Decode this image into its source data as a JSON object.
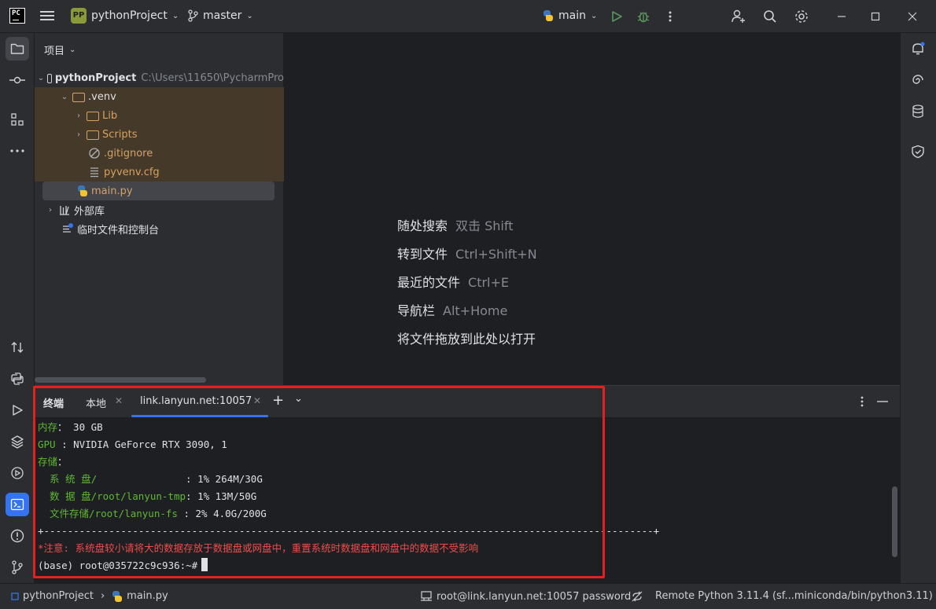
{
  "titlebar": {
    "logo": "PC",
    "project_badge": "PP",
    "project_name": "pythonProject",
    "branch": "master",
    "run_config": "main"
  },
  "project_panel": {
    "header": "项目",
    "tree": [
      {
        "label": "pythonProject",
        "hint": "C:\\Users\\11650\\PycharmPro"
      },
      {
        "label": ".venv"
      },
      {
        "label": "Lib"
      },
      {
        "label": "Scripts"
      },
      {
        "label": ".gitignore"
      },
      {
        "label": "pyvenv.cfg"
      },
      {
        "label": "main.py"
      },
      {
        "label": "外部库"
      },
      {
        "label": "临时文件和控制台"
      }
    ]
  },
  "editor_empty": {
    "rows": [
      {
        "label": "随处搜索",
        "shortcut": "双击 Shift"
      },
      {
        "label": "转到文件",
        "shortcut": "Ctrl+Shift+N"
      },
      {
        "label": "最近的文件",
        "shortcut": "Ctrl+E"
      },
      {
        "label": "导航栏",
        "shortcut": "Alt+Home"
      },
      {
        "label": "将文件拖放到此处以打开",
        "shortcut": ""
      }
    ]
  },
  "terminal": {
    "title": "终端",
    "tabs": [
      "本地",
      "link.lanyun.net:10057"
    ],
    "lines": {
      "mem_label": "内存",
      "mem_value": "： 30 GB",
      "gpu_label": "GPU",
      "gpu_value": " : NVIDIA GeForce RTX 3090, 1",
      "storage_label": "存储",
      "storage_colon": "：",
      "sys_label": "  系 统 盘/              ",
      "sys_value": " : 1% 264M/30G",
      "data_label": "  数 据 盘/root/lanyun-tmp",
      "data_value": ": 1% 13M/50G",
      "fs_label": "  文件存储/root/lanyun-fs",
      "fs_value": " : 2% 4.0G/200G",
      "separator": "+-------------------------------------------------------------------------------------------------------+",
      "notice": "*注意: 系统盘较小请将大的数据存放于数据盘或网盘中，重置系统时数据盘和网盘中的数据不受影响",
      "prompt": "(base) root@035722c9c936:~#"
    }
  },
  "statusbar": {
    "breadcrumb_project": "pythonProject",
    "breadcrumb_file": "main.py",
    "remote": "root@link.lanyun.net:10057 password",
    "interpreter": "Remote Python 3.11.4 (sf...miniconda/bin/python3.11)"
  }
}
